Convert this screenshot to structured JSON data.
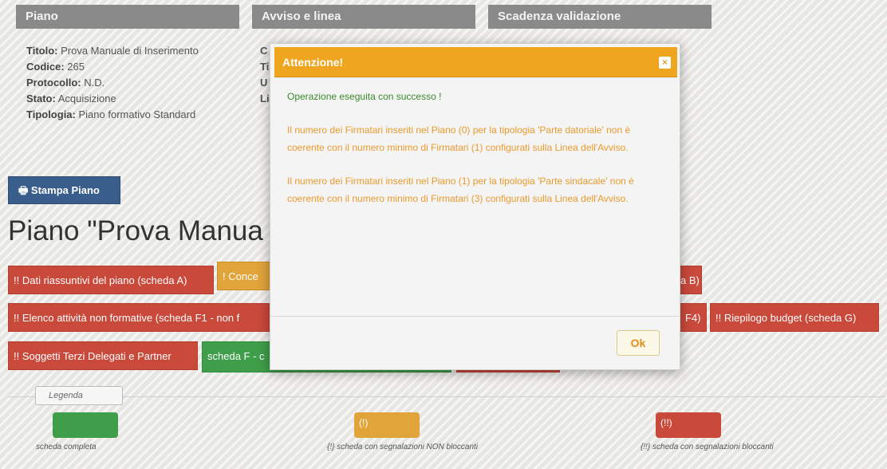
{
  "headers": {
    "piano": "Piano",
    "avviso": "Avviso e linea",
    "scadenza": "Scadenza validazione"
  },
  "info": {
    "titolo_label": "Titolo:",
    "titolo_value": "Prova Manuale di Inserimento",
    "codice_label": "Codice:",
    "codice_value": "265",
    "protocollo_label": "Protocollo:",
    "protocollo_value": "N.D.",
    "stato_label": "Stato:",
    "stato_value": "Acquisizione",
    "tipologia_label": "Tipologia:",
    "tipologia_value": "Piano formativo Standard",
    "col2_partial": [
      "C",
      "Ti",
      "U",
      "Li"
    ]
  },
  "print_button": "Stampa Piano",
  "page_title": "Piano \"Prova Manua",
  "tags": {
    "dati_riassuntivi": "!! Dati riassuntivi del piano (scheda A)",
    "conce": "! Conce",
    "b_tail": "a B)",
    "elenco": "!! Elenco attività non formative (scheda F1 - non f",
    "f4_tail": "F4)",
    "riepilogo": "!! Riepilogo budget (scheda G)",
    "soggetti": "!! Soggetti Terzi Delegati e Partner",
    "scheda_f": "scheda F - c"
  },
  "legend": {
    "title": "Legenda",
    "complete_text": "scheda completa",
    "orange_swatch": "(!)",
    "orange_text": "{!} scheda con segnalazioni NON bloccanti",
    "red_swatch": "(!!)",
    "red_text": "{!!} scheda con segnalazioni bloccanti"
  },
  "modal": {
    "title": "Attenzione!",
    "close": "×",
    "success": "Operazione eseguita con successo !",
    "warning1": "Il numero dei Firmatari inseriti nel Piano (0) per la tipologia 'Parte datoriale' non è coerente con il numero minimo di Firmatari (1) configurati sulla Linea dell'Avviso.",
    "warning2": "Il numero dei Firmatari inseriti nel Piano (1) per la tipologia 'Parte sindacale' non è coerente con il numero minimo di Firmatari (3) configurati sulla Linea dell'Avviso.",
    "ok": "Ok"
  },
  "colors": {
    "header_gray": "#8a8a8a",
    "print_blue": "#3a5e8c",
    "danger_red": "#c9493b",
    "warning_orange": "#e0a43a",
    "success_green": "#3f9e4a",
    "modal_header": "#f0a51f"
  }
}
